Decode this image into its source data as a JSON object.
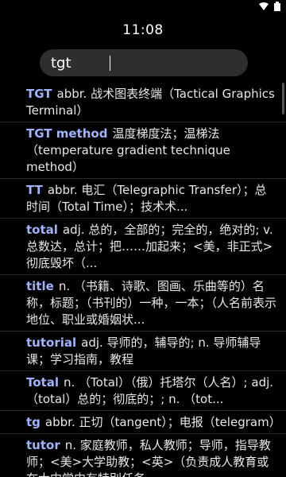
{
  "clock": "11:08",
  "search": {
    "value": "tgt"
  },
  "entries": [
    {
      "word": "TGT",
      "definition": "abbr. 战术图表终端（Tactical Graphics Terminal）"
    },
    {
      "word": "TGT method",
      "definition": "温度梯度法；温梯法（temperature gradient technique method）"
    },
    {
      "word": "TT",
      "definition": "abbr. 电汇（Telegraphic Transfer）；总时间（Total Time）；技术术..."
    },
    {
      "word": "total",
      "definition": "adj. 总的，全部的；完全的，绝对的; v. 总数达，总计；把……加起来；<美，非正式>彻底毁坏（..."
    },
    {
      "word": "title",
      "definition": "n. （书籍、诗歌、图画、乐曲等的）名称，标题；（书刊的）一种，一本；（人名前表示地位、职业或婚姻状..."
    },
    {
      "word": "tutorial",
      "definition": "adj. 导师的，辅导的; n. 导师辅导课；学习指南，教程"
    },
    {
      "word": "Total",
      "definition": "n. （Total）（俄）托塔尔（人名）; adj. （total）总的；彻底的；; n. （tot..."
    },
    {
      "word": "tg",
      "definition": "abbr. 正切（tangent）；电报（telegram）"
    },
    {
      "word": "tutor",
      "definition": "n. 家庭教师，私人教师；导师，指导教师；<美>大学助教；<英>（负责成人教育或在大中学中有特别任务..."
    }
  ]
}
